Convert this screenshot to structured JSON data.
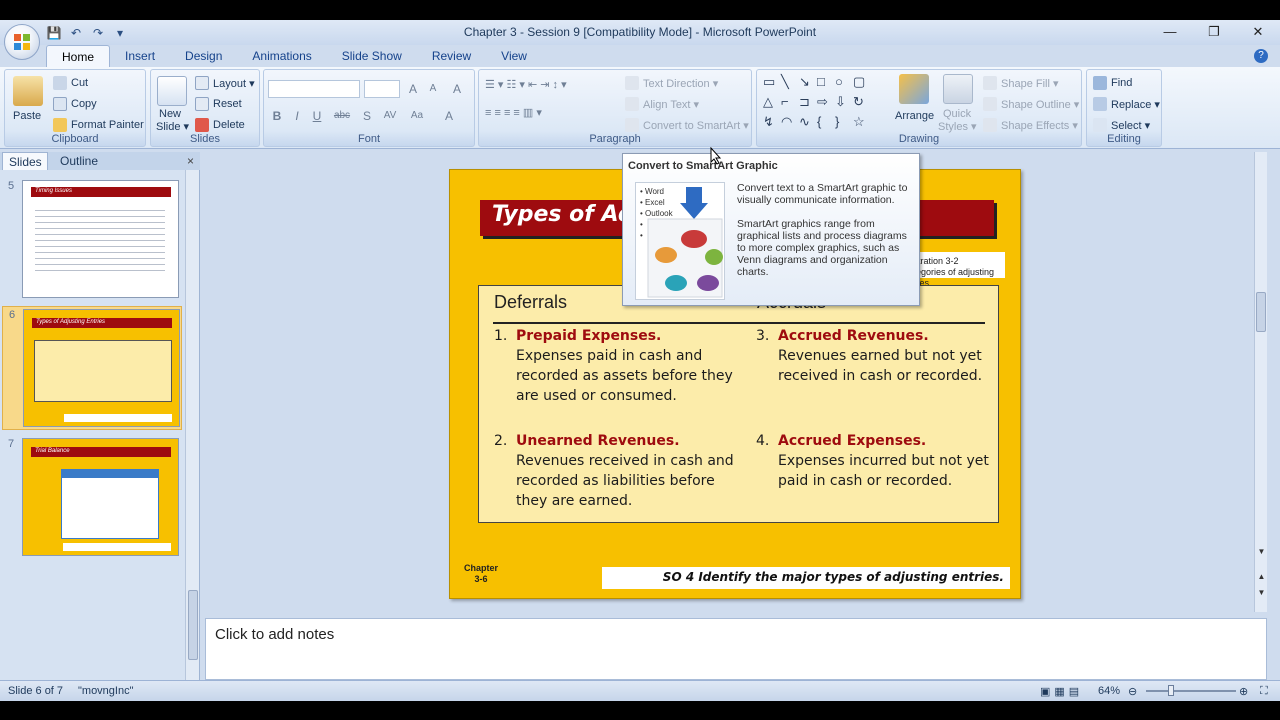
{
  "window": {
    "title": "Chapter 3 - Session 9 [Compatibility Mode] - Microsoft PowerPoint",
    "minimize": "—",
    "restore": "❐",
    "close": "✕"
  },
  "qat": {
    "save": "💾",
    "undo": "↶",
    "redo": "↷",
    "more": "▾"
  },
  "tabs": [
    "Home",
    "Insert",
    "Design",
    "Animations",
    "Slide Show",
    "Review",
    "View"
  ],
  "help": "?",
  "ribbon": {
    "clipboard": {
      "label": "Clipboard",
      "paste": "Paste",
      "cut": "Cut",
      "copy": "Copy",
      "format_painter": "Format Painter"
    },
    "slides": {
      "label": "Slides",
      "new_slide": "New",
      "new_slide2": "Slide ▾",
      "layout": "Layout ▾",
      "reset": "Reset",
      "delete": "Delete"
    },
    "font": {
      "label": "Font",
      "bold": "B",
      "italic": "I",
      "underline": "U",
      "strike": "abc",
      "shadow": "S",
      "grow": "A",
      "shrink": "A",
      "clear": "A",
      "spacing": "AV",
      "case": "Aa",
      "color": "A"
    },
    "paragraph": {
      "label": "Paragraph",
      "text_direction": "Text Direction ▾",
      "align_text": "Align Text ▾",
      "convert_smartart": "Convert to SmartArt ▾"
    },
    "drawing": {
      "label": "Drawing",
      "arrange": "Arrange",
      "quick_styles": "Quick",
      "quick_styles2": "Styles ▾",
      "shape_fill": "Shape Fill ▾",
      "shape_outline": "Shape Outline ▾",
      "shape_effects": "Shape Effects ▾"
    },
    "editing": {
      "label": "Editing",
      "find": "Find",
      "replace": "Replace ▾",
      "select": "Select ▾"
    }
  },
  "panel": {
    "tab_slides": "Slides",
    "tab_outline": "Outline",
    "close": "×",
    "thumbs": [
      {
        "num": "5",
        "title": "Timing Issues"
      },
      {
        "num": "6",
        "title": "Types of Adjusting Entries"
      },
      {
        "num": "7",
        "title": "Trial Balance"
      }
    ]
  },
  "slide": {
    "title": "Types of Adjusting Entries",
    "ref_line1": "Illustration 3-2",
    "ref_line2": "Categories of adjusting entries",
    "col1_header": "Deferrals",
    "col2_header": "Accruals",
    "items": [
      {
        "num": "1.",
        "head": "Prepaid Expenses.",
        "desc": "Expenses paid in cash and recorded as assets before they are used or consumed."
      },
      {
        "num": "3.",
        "head": "Accrued Revenues.",
        "desc": "Revenues earned but not yet received in cash or recorded."
      },
      {
        "num": "2.",
        "head": "Unearned Revenues.",
        "desc": "Revenues received in cash and recorded as liabilities before they are earned."
      },
      {
        "num": "4.",
        "head": "Accrued Expenses.",
        "desc": "Expenses incurred but not yet paid in cash or recorded."
      }
    ],
    "chapter_line1": "Chapter",
    "chapter_line2": "3-6",
    "footer": "SO 4  Identify the major types of adjusting entries."
  },
  "tooltip": {
    "title": "Convert to SmartArt Graphic",
    "pic_items": [
      "Word",
      "Excel",
      "Outlook",
      "",
      ""
    ],
    "para1": "Convert text to a SmartArt graphic to visually communicate information.",
    "para2": "SmartArt graphics range from graphical lists and process diagrams to more complex graphics, such as Venn diagrams and organization charts."
  },
  "notes": {
    "placeholder": "Click to add notes"
  },
  "status": {
    "slide": "Slide 6 of 7",
    "theme": "\"movngInc\"",
    "zoom": "64%"
  },
  "colors": {
    "slide_bg": "#f7c000",
    "title_bar": "#9e0b0f",
    "accent_text": "#9e0b0f",
    "box_bg": "#fcecaa"
  }
}
